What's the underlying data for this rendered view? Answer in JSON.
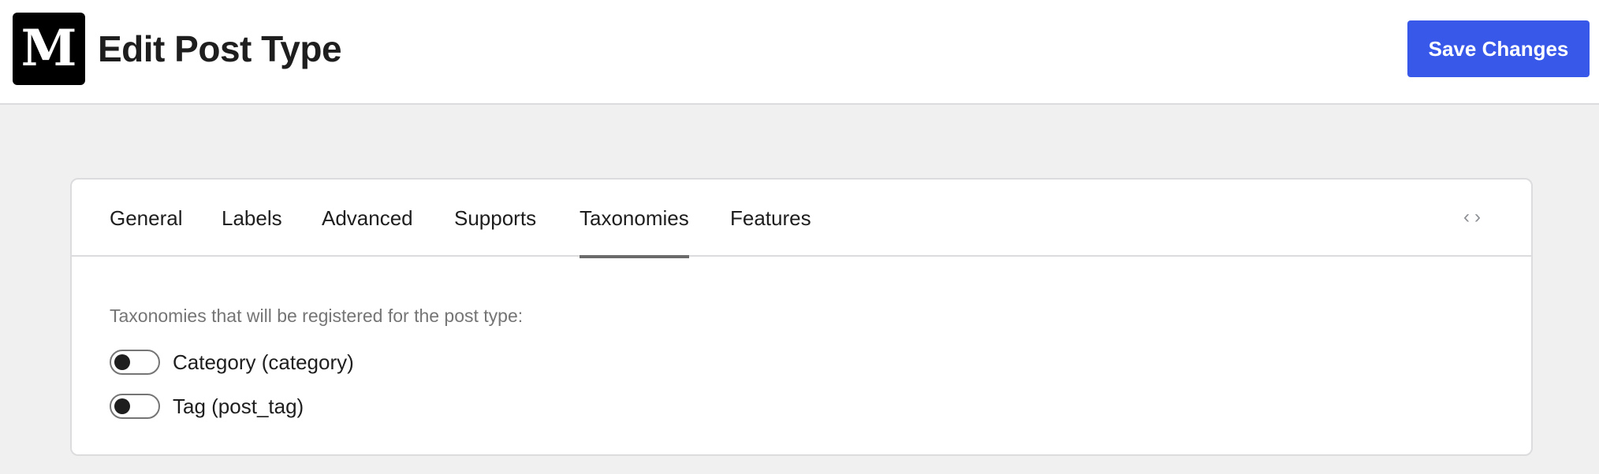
{
  "header": {
    "logo_letter": "M",
    "title": "Edit Post Type",
    "save_label": "Save Changes"
  },
  "tabs": [
    {
      "label": "General",
      "active": false
    },
    {
      "label": "Labels",
      "active": false
    },
    {
      "label": "Advanced",
      "active": false
    },
    {
      "label": "Supports",
      "active": false
    },
    {
      "label": "Taxonomies",
      "active": true
    },
    {
      "label": "Features",
      "active": false
    }
  ],
  "scroll_arrows": {
    "prev": "‹",
    "next": "›"
  },
  "taxonomies_panel": {
    "description": "Taxonomies that will be registered for the post type:",
    "items": [
      {
        "label": "Category (category)",
        "enabled": false
      },
      {
        "label": "Tag (post_tag)",
        "enabled": false
      }
    ]
  },
  "colors": {
    "accent": "#3858e9",
    "background": "#f0f0f1",
    "logo_bg": "#000000"
  },
  "icons": {
    "logo": "m-logo-icon",
    "prev": "chevron-left-icon",
    "next": "chevron-right-icon"
  }
}
